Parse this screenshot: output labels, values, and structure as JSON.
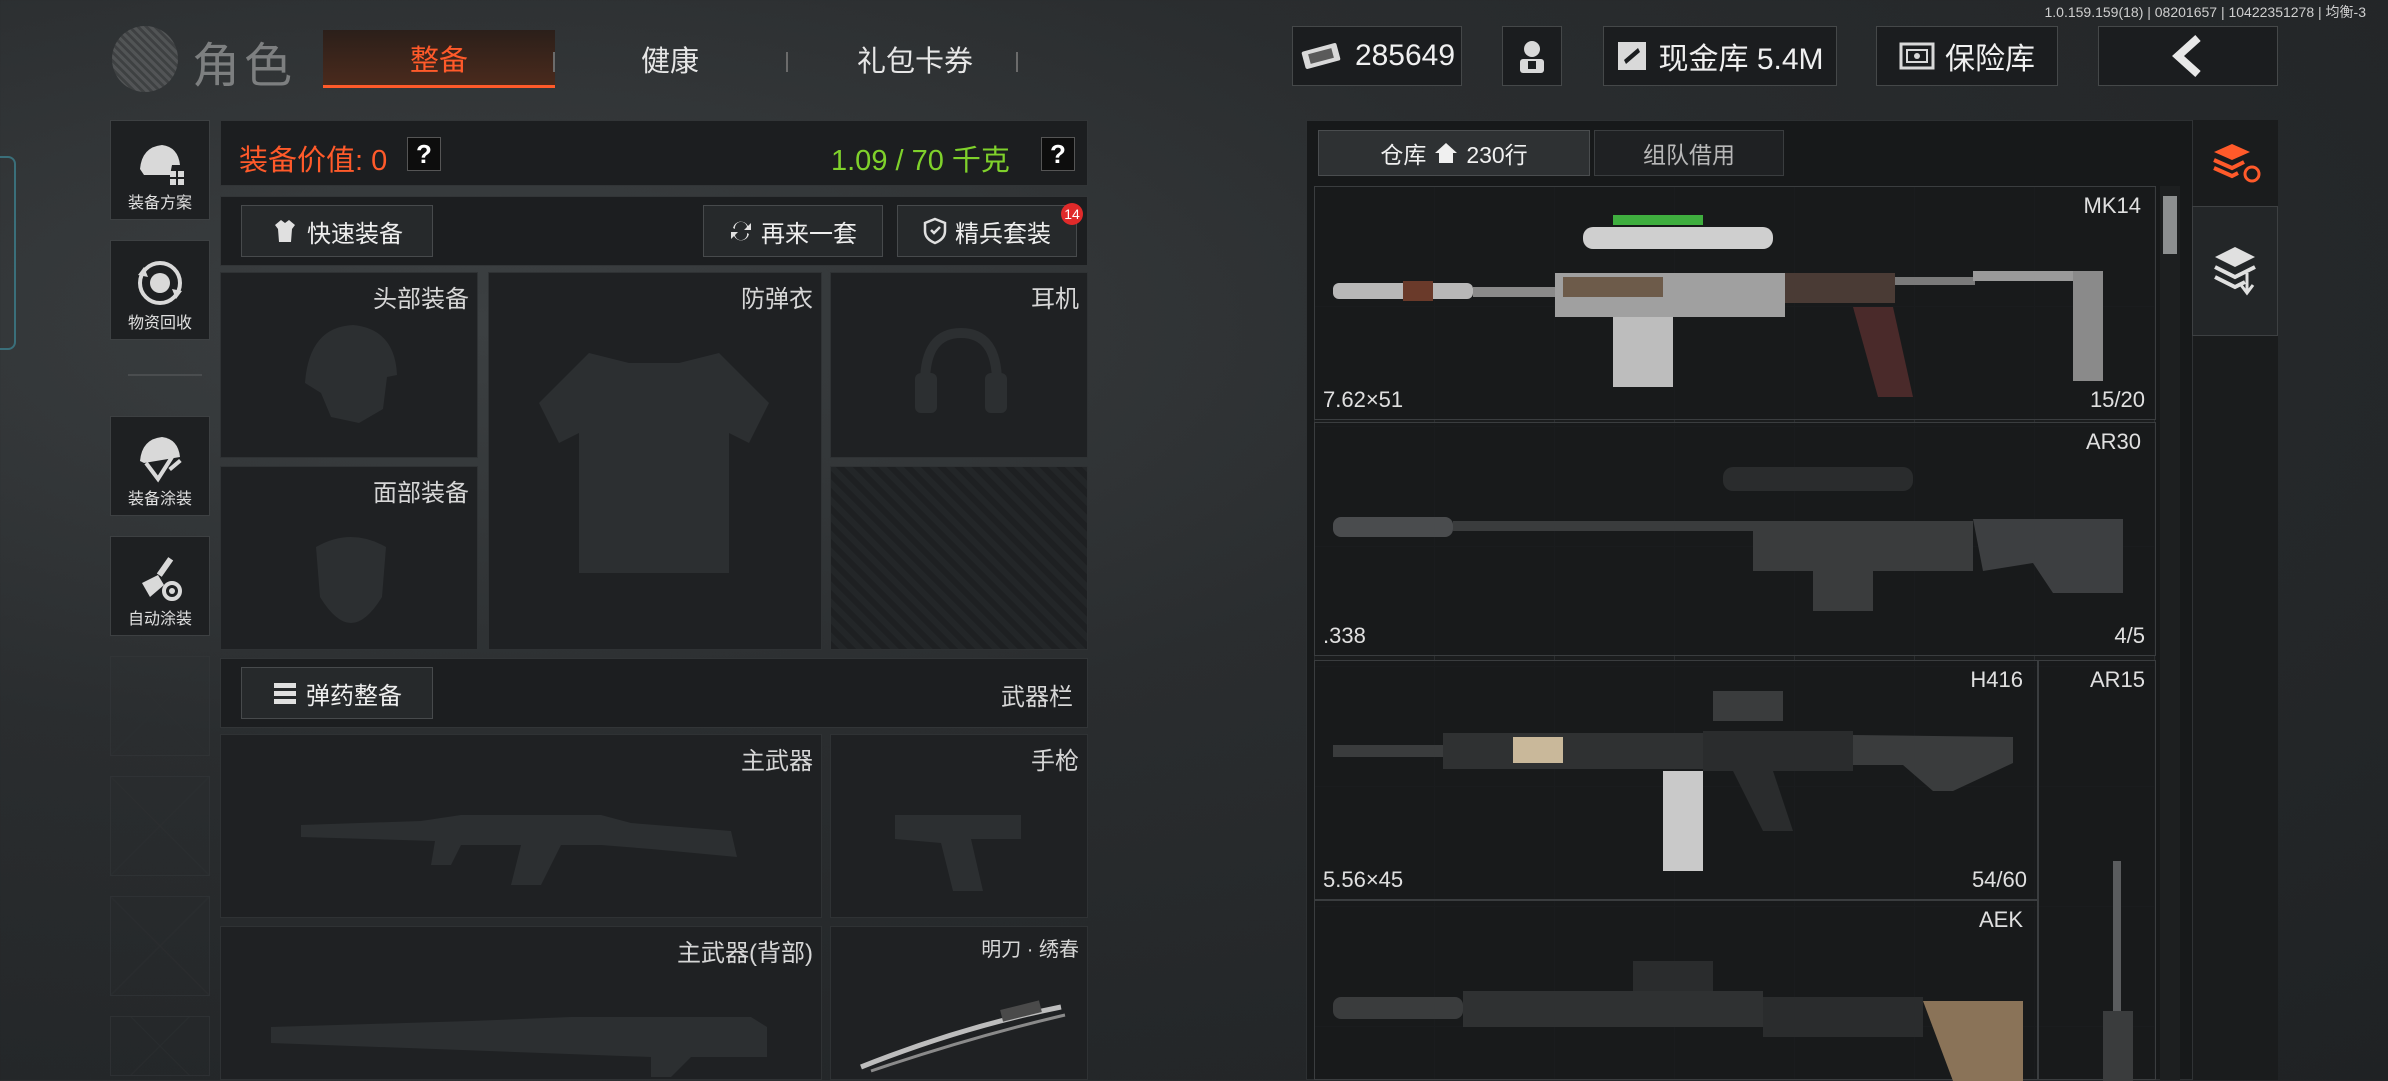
{
  "version": "1.0.159.159(18) | 08201657 | 10422351278 | 均衡-3",
  "header": {
    "title": "角色",
    "tabs": [
      "整备",
      "健康",
      "礼包卡券"
    ],
    "currency": "285649",
    "cash_vault": "现金库 5.4M",
    "safe_box": "保险库"
  },
  "sidebar": {
    "items": [
      {
        "label": "装备方案",
        "icon": "helmet-plan-icon"
      },
      {
        "label": "物资回收",
        "icon": "recycle-icon"
      },
      {
        "label": "装备涂装",
        "icon": "paint-icon"
      },
      {
        "label": "自动涂装",
        "icon": "auto-paint-icon"
      }
    ]
  },
  "equipment": {
    "value_label": "装备价值: 0",
    "weight": "1.09 / 70 千克",
    "quick_equip": "快速装备",
    "again": "再来一套",
    "elite": "精兵套装",
    "elite_badge": "14",
    "slots": {
      "head": "头部装备",
      "armor": "防弹衣",
      "headset": "耳机",
      "face": "面部装备",
      "ammo_btn": "弹药整备",
      "weapon_bar": "武器栏",
      "primary": "主武器",
      "pistol": "手枪",
      "primary_back": "主武器(背部)",
      "melee": "明刀 · 绣春"
    }
  },
  "warehouse": {
    "tab_storage": "仓库",
    "rows": "230行",
    "tab_team": "组队借用",
    "items": [
      {
        "name": "MK14",
        "caliber": "7.62×51",
        "ammo": "15/20"
      },
      {
        "name": "AR30",
        "caliber": ".338",
        "ammo": "4/5"
      },
      {
        "name": "H416",
        "caliber": "5.56×45",
        "ammo": "54/60"
      },
      {
        "name": "AR15",
        "caliber": "",
        "ammo": ""
      },
      {
        "name": "AEK",
        "caliber": "",
        "ammo": ""
      }
    ]
  },
  "colors": {
    "accent": "#ff5a2a",
    "weight_green": "#7fd12b",
    "badge": "#e02a2a"
  }
}
